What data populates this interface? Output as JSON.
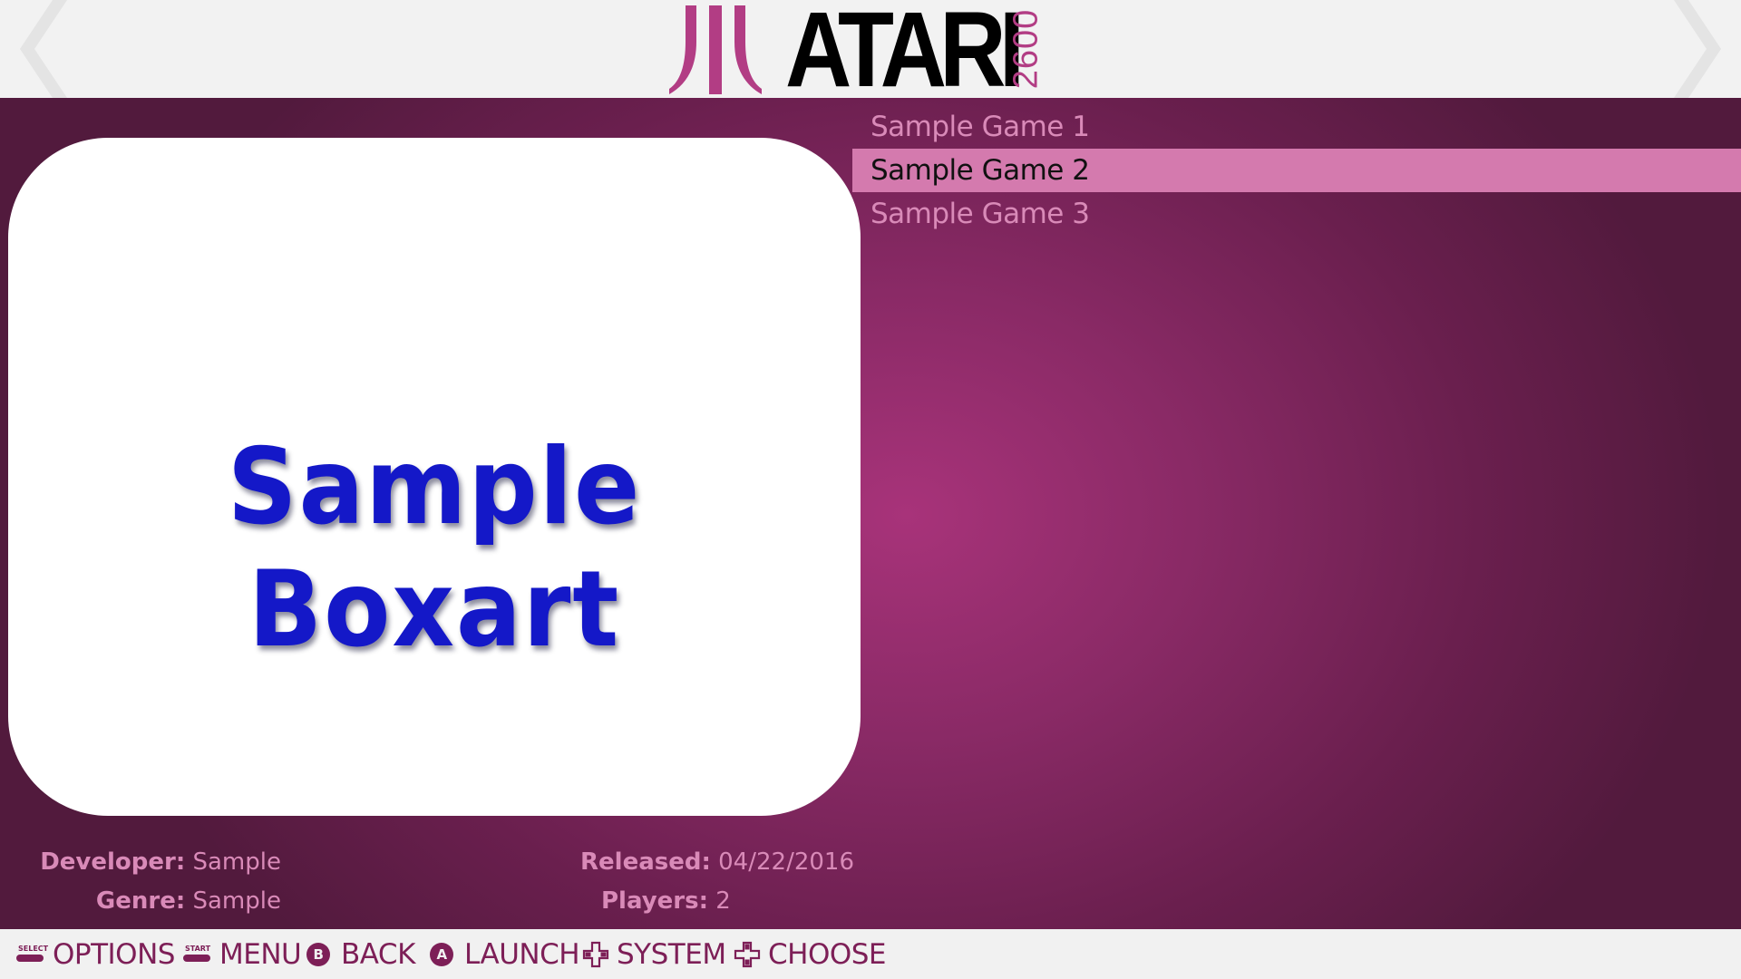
{
  "header": {
    "logo_text": "ATARI",
    "logo_sub": "2600"
  },
  "boxart": {
    "text": "Sample Boxart"
  },
  "gamelist": {
    "items": [
      {
        "label": "Sample Game 1",
        "selected": false
      },
      {
        "label": "Sample Game 2",
        "selected": true
      },
      {
        "label": "Sample Game 3",
        "selected": false
      }
    ]
  },
  "metadata": {
    "developer_label": "Developer:",
    "developer_value": "Sample",
    "genre_label": "Genre:",
    "genre_value": "Sample",
    "released_label": "Released:",
    "released_value": "04/22/2016",
    "players_label": "Players:",
    "players_value": "2"
  },
  "footer": {
    "select_cap": "SELECT",
    "options_label": "OPTIONS",
    "start_cap": "START",
    "menu_label": "MENU",
    "b_button": "B",
    "back_label": "BACK",
    "a_button": "A",
    "launch_label": "LAUNCH",
    "system_label": "SYSTEM",
    "choose_label": "CHOOSE"
  },
  "colors": {
    "accent": "#b23d84",
    "selected_bg": "#d47aae",
    "list_text": "#d98ab8",
    "footer_text": "#7d1f57",
    "boxart_text": "#1418c8"
  },
  "icons": [
    "chevron-left-icon",
    "chevron-right-icon",
    "atari-fuji-icon",
    "select-button-icon",
    "start-button-icon",
    "b-button-icon",
    "a-button-icon",
    "dpad-left-right-icon",
    "dpad-up-down-icon"
  ]
}
